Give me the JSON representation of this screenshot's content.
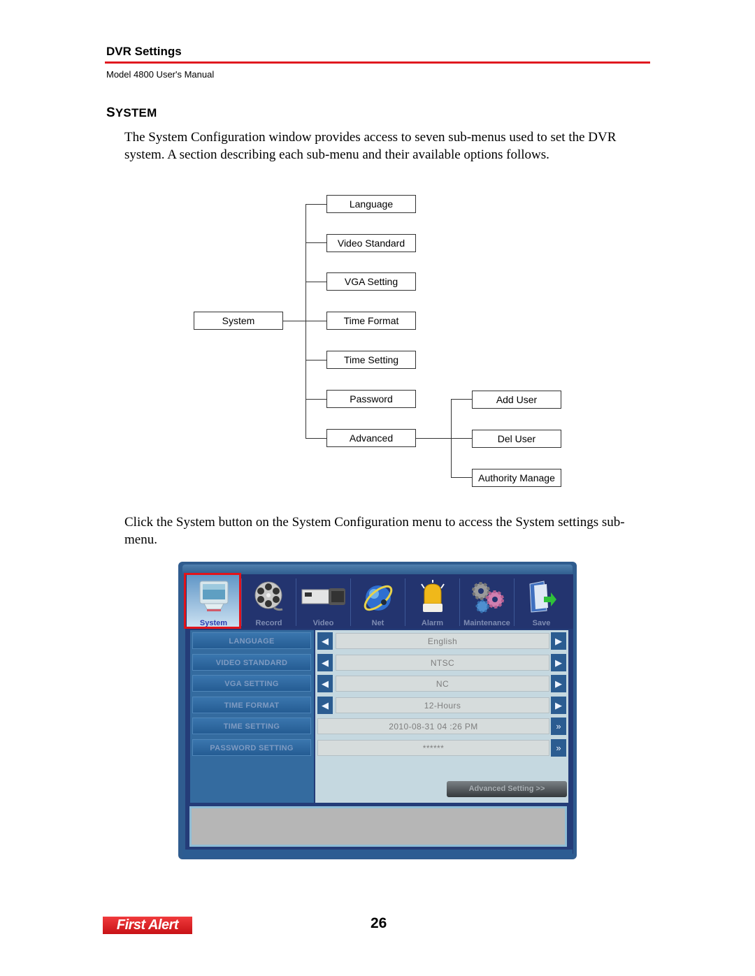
{
  "header": {
    "title": "DVR Settings",
    "subtitle": "Model 4800 User's Manual",
    "rule_color": "#e0191f"
  },
  "section": {
    "title_initial": "S",
    "title_rest": "YSTEM",
    "intro": "The System Configuration window provides access to seven sub-menus used to set the DVR system. A section describing each sub-menu and their available options follows.",
    "instruction": "Click the System button on the System Configuration menu to access the System settings sub-menu."
  },
  "diagram": {
    "root": "System",
    "children": [
      "Language",
      "Video Standard",
      "VGA Setting",
      "Time Format",
      "Time Setting",
      "Password",
      "Advanced"
    ],
    "advanced_children": [
      "Add User",
      "Del User",
      "Authority Manage"
    ]
  },
  "dvr": {
    "tabs": [
      {
        "label": "System",
        "icon": "monitor-icon",
        "selected": true
      },
      {
        "label": "Record",
        "icon": "film-reel-icon",
        "selected": false
      },
      {
        "label": "Video",
        "icon": "camera-icon",
        "selected": false
      },
      {
        "label": "Net",
        "icon": "globe-icon",
        "selected": false
      },
      {
        "label": "Alarm",
        "icon": "alarm-light-icon",
        "selected": false
      },
      {
        "label": "Maintenance",
        "icon": "gears-icon",
        "selected": false
      },
      {
        "label": "Save",
        "icon": "save-icon",
        "selected": false
      }
    ],
    "settings": [
      {
        "label": "LANGUAGE",
        "value": "English",
        "control": "arrows"
      },
      {
        "label": "VIDEO STANDARD",
        "value": "NTSC",
        "control": "arrows"
      },
      {
        "label": "VGA SETTING",
        "value": "NC",
        "control": "arrows"
      },
      {
        "label": "TIME FORMAT",
        "value": "12-Hours",
        "control": "arrows"
      },
      {
        "label": "TIME SETTING",
        "value": "2010-08-31 04 :26  PM",
        "control": "expand"
      },
      {
        "label": "PASSWORD SETTING",
        "value": "******",
        "control": "expand"
      }
    ],
    "advanced_button": "Advanced Setting >>",
    "highlight_color": "#e2141b"
  },
  "footer": {
    "logo": "First Alert",
    "page_number": "26"
  }
}
